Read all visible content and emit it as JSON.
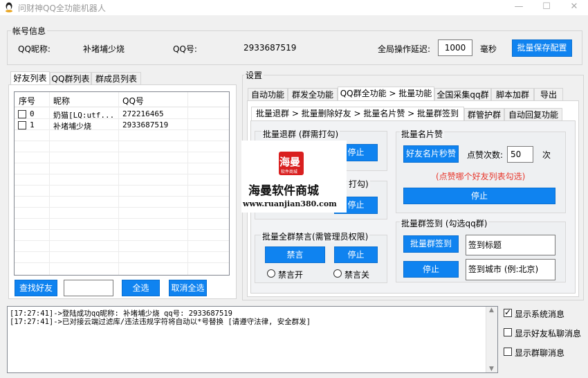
{
  "window": {
    "title": "问财神QQ全功能机器人",
    "minimize": "—",
    "maximize": "☐",
    "close": "✕"
  },
  "account": {
    "group_label": "帐号信息",
    "nickname_label": "QQ昵称:",
    "nickname_value": "补堵埔少烧",
    "qq_label": "QQ号:",
    "qq_value": "2933687519",
    "delay_label": "全局操作延迟:",
    "delay_value": "1000",
    "delay_unit": "毫秒",
    "save_button": "批量保存配置"
  },
  "left_tabs": [
    "好友列表",
    "QQ群列表",
    "群成员列表"
  ],
  "friend_table": {
    "columns": [
      "序号",
      "昵称",
      "QQ号"
    ],
    "rows": [
      {
        "index": "0",
        "nick": "奶猫[LQ:utf...",
        "qq": "272216465",
        "checked": false
      },
      {
        "index": "1",
        "nick": "补堵埔少烧",
        "qq": "2933687519",
        "checked": false
      }
    ]
  },
  "left_buttons": {
    "find": "查找好友",
    "search_value": "",
    "select_all": "全选",
    "deselect_all": "取消全选"
  },
  "settings": {
    "group_label": "设置",
    "main_tabs": [
      "自动功能",
      "群发全功能",
      "QQ群全功能 > 批量功能",
      "全国采集qq群",
      "脚本加群",
      "导出"
    ],
    "sub_tabs": [
      "批量退群 > 批量删除好友 > 批量名片赞 > 批量群签到",
      "群管护群",
      "自动回复功能"
    ],
    "quit_group": {
      "title": "批量退群 (群需打勾)",
      "stop": "停止"
    },
    "delete_friend": {
      "title": "打勾)",
      "stop": "停止"
    },
    "mute": {
      "title": "批量全群禁言(需管理员权限)",
      "mute_btn": "禁言",
      "stop": "停止",
      "mute_on": "禁言开",
      "mute_off": "禁言关"
    },
    "like": {
      "title": "批量名片赞",
      "like_btn": "好友名片秒赞",
      "count_label": "点赞次数:",
      "count_value": "50",
      "count_unit": "次",
      "hint": "(点赞哪个好友列表勾选)",
      "stop": "停止"
    },
    "signin": {
      "title": "批量群签到 (勾选qq群)",
      "sign_btn": "批量群签到",
      "stop": "停止",
      "title_placeholder": "签到标题",
      "city_placeholder": "签到城市 (例:北京)"
    }
  },
  "watermark": {
    "logo_text": "海曼",
    "logo_sub": "软件商城",
    "title": "海曼软件商城",
    "url": "www.ruanjian380.com"
  },
  "log": {
    "lines": [
      "[17:27:41]->登陆成功qq昵称: 补堵埔少烧 qq号: 2933687519",
      "[17:27:41]->已对接云端过滤库/违法违规字符将自动以*号替换 [请遵守法律, 安全群发]"
    ]
  },
  "log_options": [
    {
      "label": "显示系统消息",
      "checked": true
    },
    {
      "label": "显示好友私聊消息",
      "checked": false
    },
    {
      "label": "显示群聊消息",
      "checked": false
    }
  ],
  "colors": {
    "accent": "#0f83f0",
    "hint_red": "#e8372c",
    "logo_red": "#d92020"
  }
}
